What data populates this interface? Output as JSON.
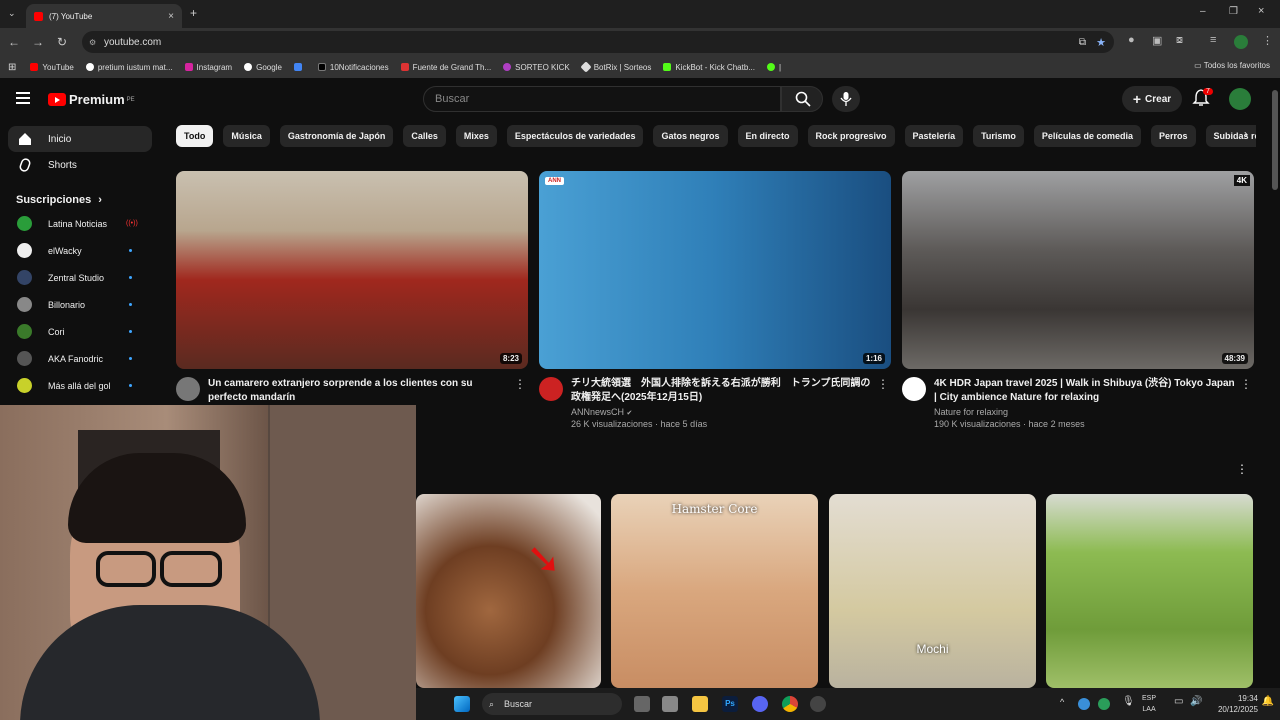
{
  "browser": {
    "tab_title": "(7) YouTube",
    "url": "youtube.com",
    "bookmarks": [
      "YouTube",
      "pretium iustum mat...",
      "Instagram",
      "Google",
      "",
      "10Notificaciones",
      "Fuente de Grand Th...",
      "SORTEO KICK",
      "BotRix | Sorteos",
      "KickBot - Kick Chatb...",
      ""
    ],
    "all_favorites": "Todos los favoritos"
  },
  "header": {
    "logo_text": "Premium",
    "logo_region": "PE",
    "search_placeholder": "Buscar",
    "create_label": "Crear",
    "notifications_count": "7"
  },
  "sidebar": {
    "home": "Inicio",
    "shorts": "Shorts",
    "subscriptions_title": "Suscripciones",
    "subs": [
      {
        "name": "Latina Noticias",
        "color": "#2a9d3a",
        "live": true
      },
      {
        "name": "elWacky",
        "color": "#eeeeee",
        "live": false
      },
      {
        "name": "Zentral Studio",
        "color": "#334466",
        "live": false
      },
      {
        "name": "Billonario",
        "color": "#888888",
        "live": false
      },
      {
        "name": "Cori",
        "color": "#3a7a2a",
        "live": false
      },
      {
        "name": "AKA Fanodric",
        "color": "#555555",
        "live": false
      },
      {
        "name": "Más allá del gol",
        "color": "#c8d12a",
        "live": false
      }
    ]
  },
  "chips": [
    "Todo",
    "Música",
    "Gastronomía de Japón",
    "Calles",
    "Mixes",
    "Espectáculos de variedades",
    "Gatos negros",
    "En directo",
    "Rock progresivo",
    "Pastelería",
    "Turismo",
    "Películas de comedia",
    "Perros",
    "Subidas recientes"
  ],
  "videos": [
    {
      "title": "Un camarero extranjero sorprende a los clientes con su perfecto mandarín",
      "channel": "",
      "stats": "",
      "duration": "8:23",
      "thumb_color": "#6b2a22",
      "avatar_color": "#777"
    },
    {
      "title": "チリ大統領選　外国人排除を訴える右派が勝利　トランプ氏同調の政権発足へ(2025年12月15日)",
      "channel": "ANNnewsCH",
      "stats": "26 K visualizaciones · hace 5 días",
      "duration": "1:16",
      "thumb_color": "#3b8fc2",
      "avatar_color": "#c22"
    },
    {
      "title": "4K HDR Japan travel 2025 | Walk in Shibuya (渋谷) Tokyo Japan | City ambience Nature for relaxing",
      "channel": "Nature for relaxing",
      "stats": "190 K visualizaciones · hace 2 meses",
      "duration": "48:39",
      "thumb_color": "#6c6a68",
      "avatar_color": "#fff"
    }
  ],
  "shorts": [
    {
      "label": "",
      "color": "#7a4a2c"
    },
    {
      "label": "Hamster Core",
      "color": "#d8a97e"
    },
    {
      "label": "Mochi",
      "color": "#c2b9a8"
    },
    {
      "label": "",
      "color": "#7fae4a"
    }
  ],
  "taskbar": {
    "search": "Buscar",
    "lang": "ESP",
    "lang_sub": "LAA",
    "time": "19:34",
    "date": "20/12/2025"
  }
}
